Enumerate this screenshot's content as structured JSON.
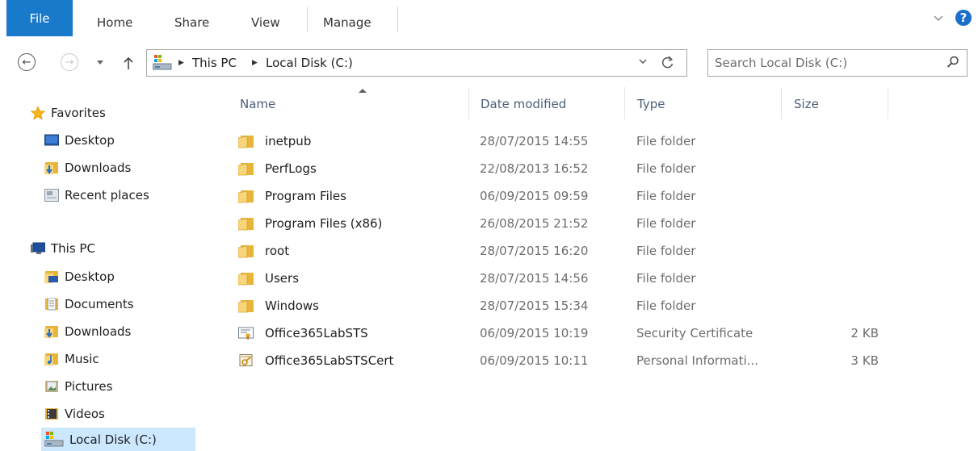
{
  "ribbon": {
    "tabs": [
      "File",
      "Home",
      "Share",
      "View",
      "Manage"
    ],
    "help_label": "?"
  },
  "nav": {
    "breadcrumb": [
      "This PC",
      "Local Disk (C:)"
    ],
    "search_placeholder": "Search Local Disk (C:)"
  },
  "sidebar": {
    "favorites_label": "Favorites",
    "favorites": [
      {
        "label": "Desktop",
        "icon": "desktop-icon"
      },
      {
        "label": "Downloads",
        "icon": "downloads-folder-icon"
      },
      {
        "label": "Recent places",
        "icon": "recent-places-icon"
      }
    ],
    "thispc_label": "This PC",
    "thispc": [
      {
        "label": "Desktop",
        "icon": "desktop-folder-icon"
      },
      {
        "label": "Documents",
        "icon": "documents-icon"
      },
      {
        "label": "Downloads",
        "icon": "downloads-folder-icon"
      },
      {
        "label": "Music",
        "icon": "music-icon"
      },
      {
        "label": "Pictures",
        "icon": "pictures-icon"
      },
      {
        "label": "Videos",
        "icon": "videos-icon"
      },
      {
        "label": "Local Disk (C:)",
        "icon": "local-disk-icon"
      }
    ]
  },
  "columns": {
    "name": "Name",
    "date": "Date modified",
    "type": "Type",
    "size": "Size"
  },
  "files": [
    {
      "name": "inetpub",
      "date": "28/07/2015 14:55",
      "type": "File folder",
      "size": "",
      "icon": "folder"
    },
    {
      "name": "PerfLogs",
      "date": "22/08/2013 16:52",
      "type": "File folder",
      "size": "",
      "icon": "folder"
    },
    {
      "name": "Program Files",
      "date": "06/09/2015 09:59",
      "type": "File folder",
      "size": "",
      "icon": "folder"
    },
    {
      "name": "Program Files (x86)",
      "date": "26/08/2015 21:52",
      "type": "File folder",
      "size": "",
      "icon": "folder"
    },
    {
      "name": "root",
      "date": "28/07/2015 16:20",
      "type": "File folder",
      "size": "",
      "icon": "folder"
    },
    {
      "name": "Users",
      "date": "28/07/2015 14:56",
      "type": "File folder",
      "size": "",
      "icon": "folder"
    },
    {
      "name": "Windows",
      "date": "28/07/2015 15:34",
      "type": "File folder",
      "size": "",
      "icon": "folder"
    },
    {
      "name": "Office365LabSTS",
      "date": "06/09/2015 10:19",
      "type": "Security Certificate",
      "size": "2 KB",
      "icon": "certificate"
    },
    {
      "name": "Office365LabSTSCert",
      "date": "06/09/2015 10:11",
      "type": "Personal Informati...",
      "size": "3 KB",
      "icon": "pfx"
    }
  ],
  "colors": {
    "file_tab": "#1979ca",
    "selected": "#cce8ff",
    "folder": "#e8b43a",
    "header_text": "#4c607a"
  }
}
